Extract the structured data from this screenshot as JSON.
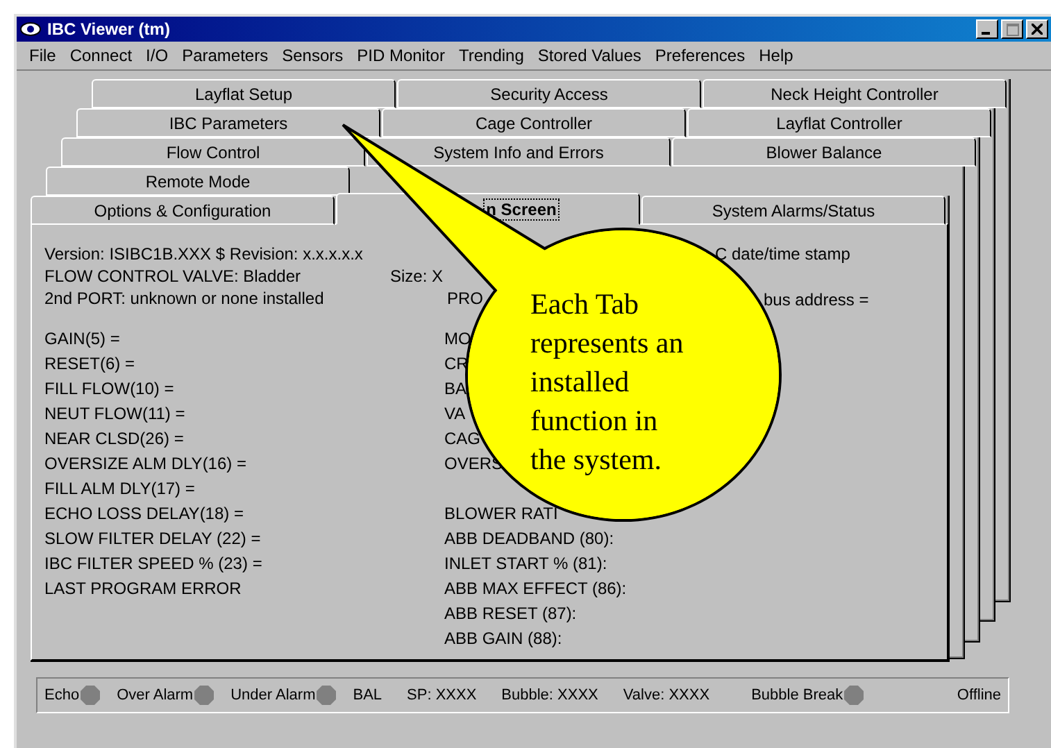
{
  "window": {
    "title": "IBC Viewer (tm)"
  },
  "menu": [
    "File",
    "Connect",
    "I/O",
    "Parameters",
    "Sensors",
    "PID Monitor",
    "Trending",
    "Stored Values",
    "Preferences",
    "Help"
  ],
  "tab_rows": [
    {
      "tabs": [
        {
          "label": "Layflat Setup",
          "selected": false
        },
        {
          "label": "Security Access",
          "selected": false
        },
        {
          "label": "Neck Height Controller",
          "selected": false
        }
      ]
    },
    {
      "tabs": [
        {
          "label": "IBC Parameters",
          "selected": false
        },
        {
          "label": "Cage Controller",
          "selected": false
        },
        {
          "label": "Layflat Controller",
          "selected": false
        }
      ]
    },
    {
      "tabs": [
        {
          "label": "Flow Control",
          "selected": false
        },
        {
          "label": "System Info and Errors",
          "selected": false
        },
        {
          "label": "Blower Balance",
          "selected": false
        }
      ]
    },
    {
      "tabs": [
        {
          "label": "Remote Mode",
          "selected": false
        }
      ]
    },
    {
      "tabs": [
        {
          "label": "Options & Configuration",
          "selected": false
        },
        {
          "label": "n Screen",
          "selected": true
        },
        {
          "label": "System Alarms/Status",
          "selected": false
        }
      ]
    }
  ],
  "panel": {
    "header": [
      "Version: ISIBC1B.XXX $ Revision: x.x.x.x.x",
      "FLOW CONTROL VALVE:  Bladder",
      "2nd PORT: unknown or none installed"
    ],
    "size": "Size:  X",
    "left_params": [
      "GAIN(5) =",
      "RESET(6) =",
      "FILL FLOW(10) =",
      "NEUT FLOW(11) =",
      "NEAR CLSD(26) =",
      "OVERSIZE ALM DLY(16) =",
      "FILL ALM DLY(17) =",
      "ECHO LOSS DELAY(18) =",
      "SLOW FILTER DELAY (22) =",
      "IBC FILTER SPEED % (23) =",
      "LAST PROGRAM ERROR"
    ],
    "middle_heading": "PRO",
    "middle_params_a": [
      "MO",
      "CR",
      "BA",
      "VA",
      "CAG",
      "OVERS"
    ],
    "middle_params_b": [
      "BLOWER RATI",
      "ABB DEADBAND (80):",
      "INLET START % (81):",
      "ABB MAX EFFECT (86):",
      "ABB RESET (87):",
      "ABB GAIN (88):"
    ],
    "right": [
      "C date/time stamp",
      "bus address ="
    ]
  },
  "callout": {
    "lines": [
      "Each Tab",
      "represents an",
      "installed",
      "function in",
      "the system."
    ]
  },
  "status_bar": [
    {
      "kind": "lamp",
      "label": "Echo",
      "lit": false
    },
    {
      "kind": "lamp",
      "label": "Over Alarm",
      "lit": false
    },
    {
      "kind": "lamp",
      "label": "Under Alarm",
      "lit": false
    },
    {
      "kind": "text",
      "label": "BAL"
    },
    {
      "kind": "text",
      "label": "SP: XXXX"
    },
    {
      "kind": "text",
      "label": "Bubble: XXXX"
    },
    {
      "kind": "text",
      "label": "Valve: XXXX"
    },
    {
      "kind": "lamp",
      "label": "Bubble Break",
      "lit": false
    },
    {
      "kind": "text",
      "label": "Offline"
    }
  ]
}
